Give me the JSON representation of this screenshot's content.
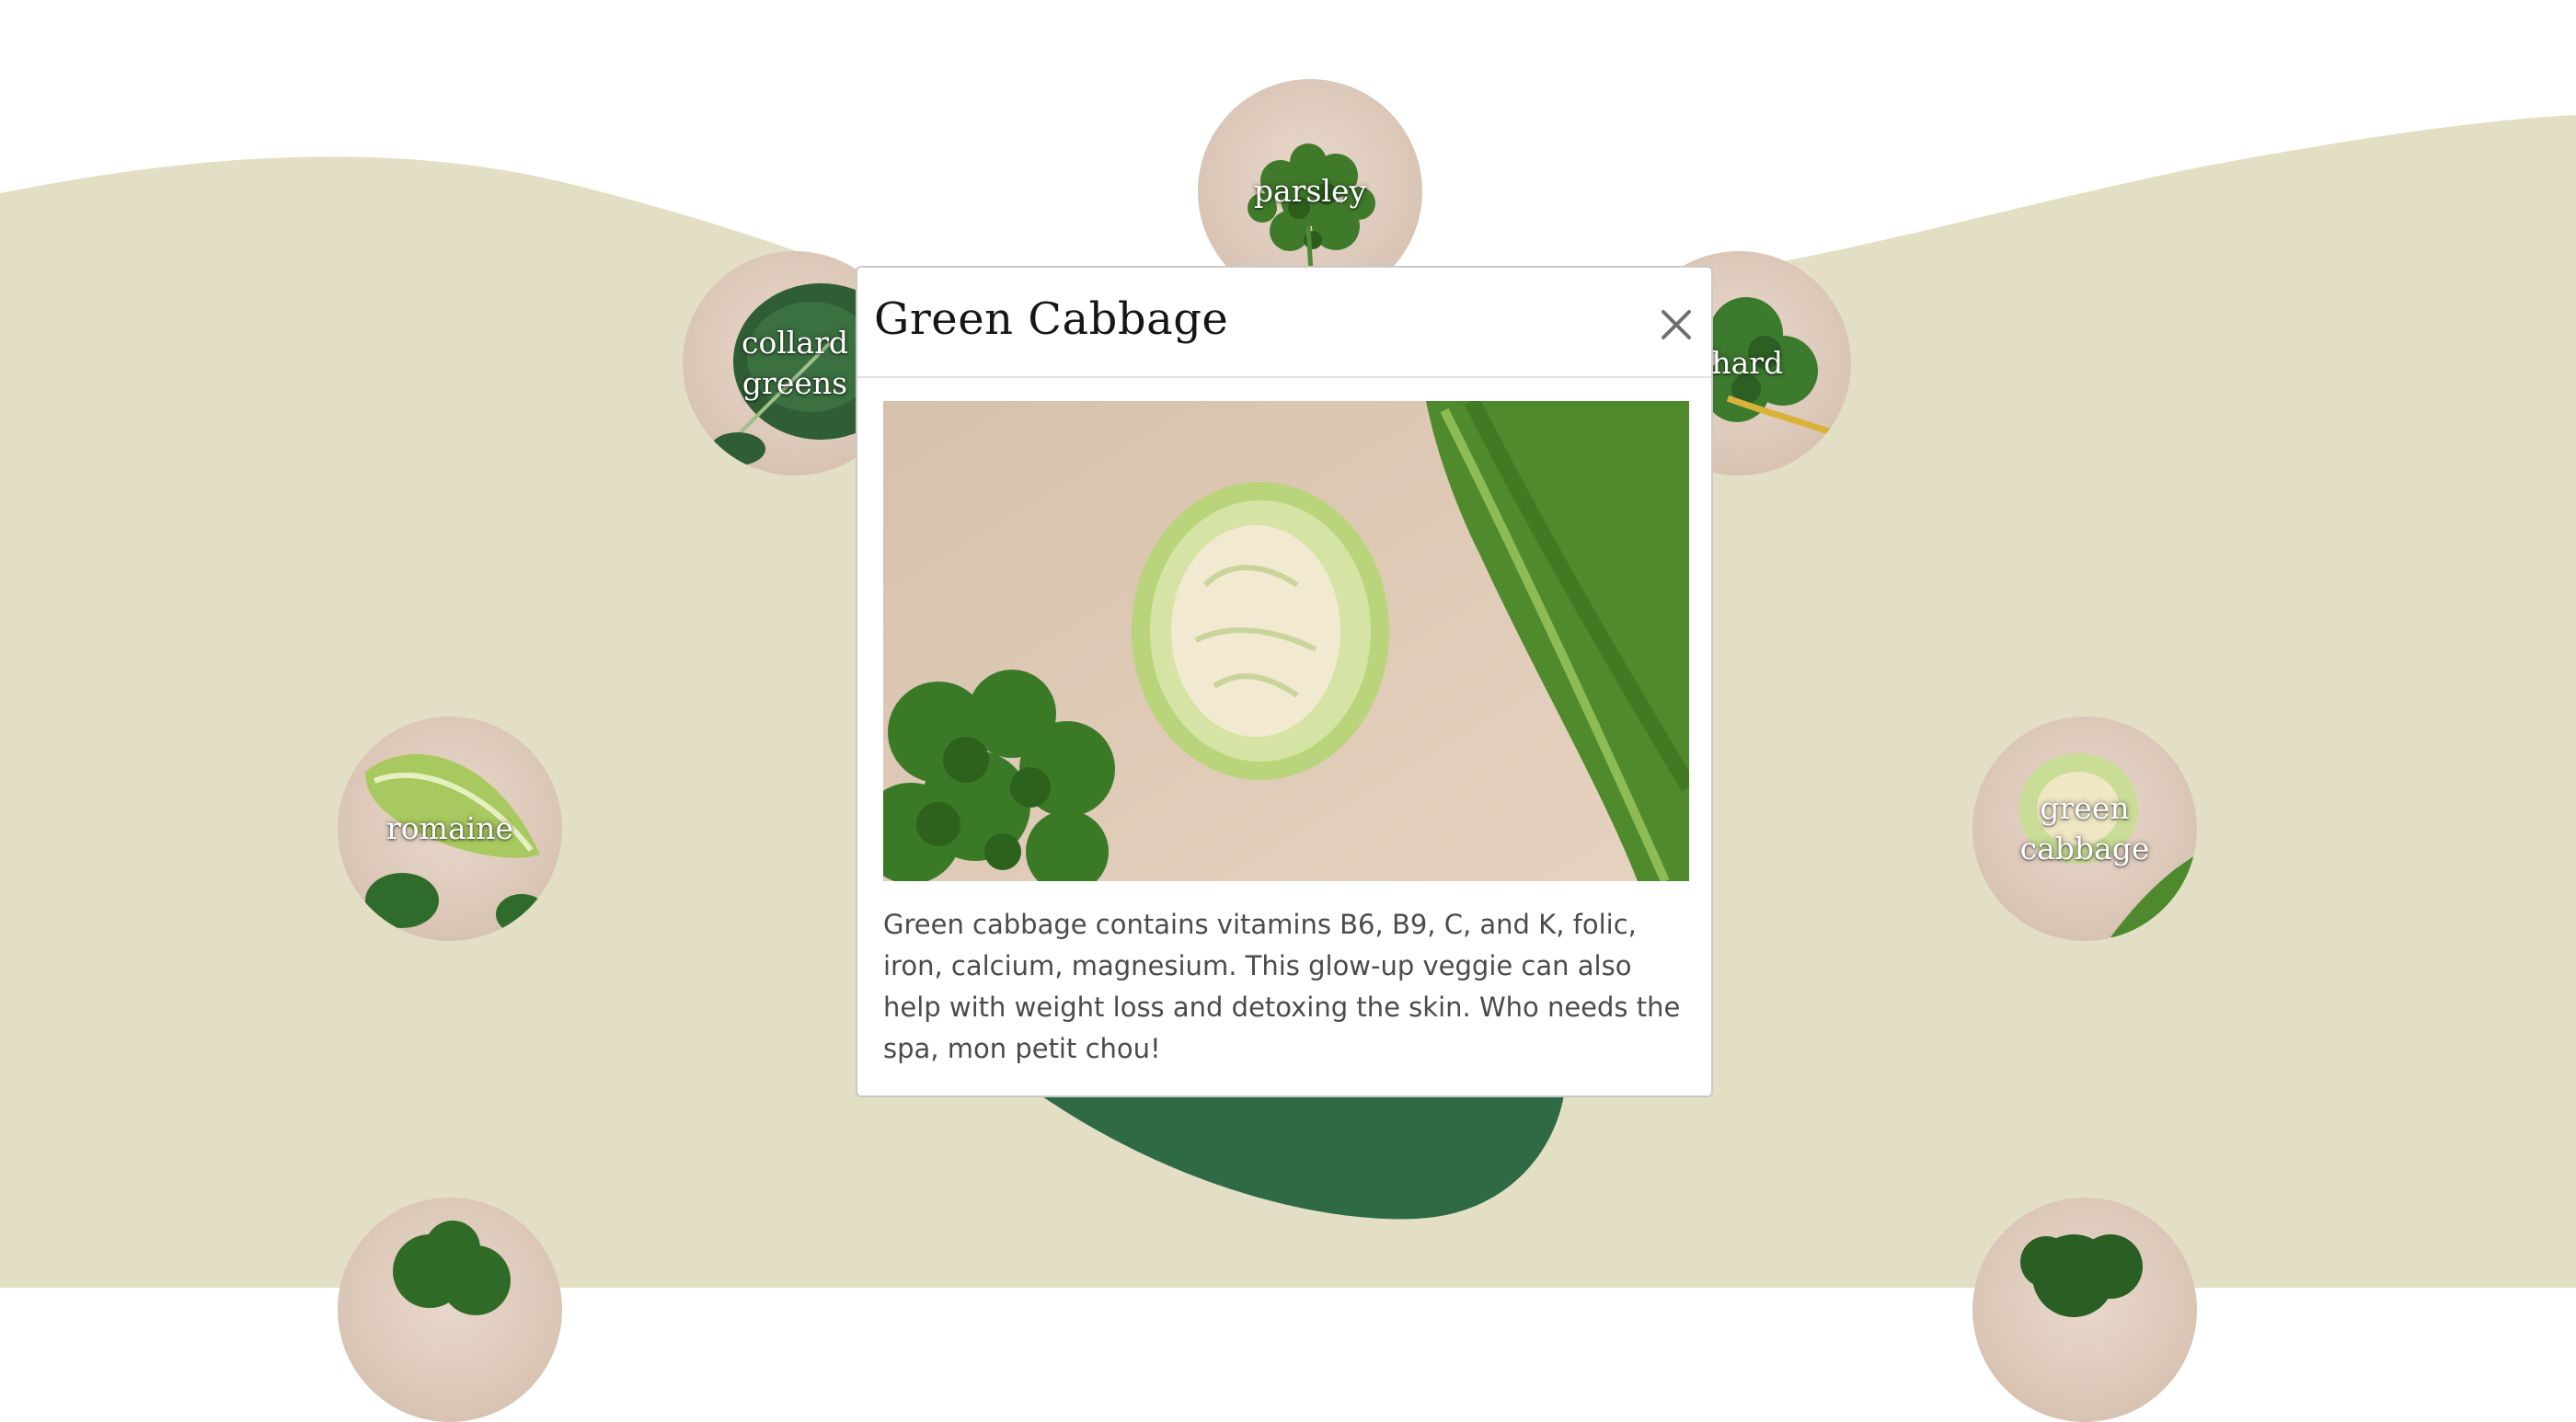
{
  "vegetables": [
    {
      "label": "parsley"
    },
    {
      "label": "collard\ngreens"
    },
    {
      "label": "chard"
    },
    {
      "label": "romaine"
    },
    {
      "label": "green\ncabbage"
    },
    {
      "label": ""
    },
    {
      "label": ""
    }
  ],
  "modal": {
    "title": "Green Cabbage",
    "close_icon": "close-icon",
    "description": "Green cabbage contains vitamins B6, B9, C, and K, folic, iron, calcium, magnesium. This glow-up veggie can also help with weight loss and detoxing the skin. Who needs the spa, mon petit chou!"
  },
  "colors": {
    "background": "#ffffff",
    "wave": "#e3dfc5",
    "blob": "#2e6b45",
    "label_text": "#ffffff",
    "modal_title": "#161616",
    "modal_text": "#4b4b4b"
  }
}
